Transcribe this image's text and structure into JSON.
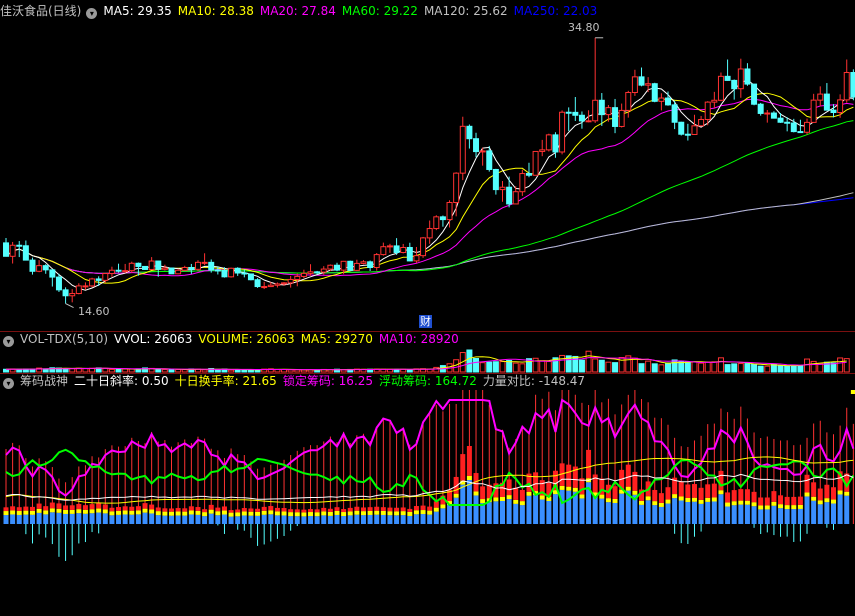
{
  "main_legend": {
    "title": "佳沃食品(日线)",
    "items": [
      {
        "text": "MA5: 29.35",
        "color": "#ffffff"
      },
      {
        "text": "MA10: 28.38",
        "color": "#ffff00"
      },
      {
        "text": "MA20: 27.84",
        "color": "#ff00ff"
      },
      {
        "text": "MA60: 29.22",
        "color": "#00ff00"
      },
      {
        "text": "MA120: 25.62",
        "color": "#c0c0c0"
      },
      {
        "text": "MA250: 22.03",
        "color": "#0000ff"
      }
    ]
  },
  "high_label": "34.80",
  "low_label": "14.60",
  "cai_marker": "财",
  "vol_legend": {
    "items": [
      {
        "text": "VOL-TDX(5,10)",
        "color": "#c0c0c0"
      },
      {
        "text": "VVOL: 26063",
        "color": "#ffffff"
      },
      {
        "text": "VOLUME: 26063",
        "color": "#ffff00"
      },
      {
        "text": "MA5: 29270",
        "color": "#ffff00"
      },
      {
        "text": "MA10: 28920",
        "color": "#ff00ff"
      }
    ]
  },
  "ind_legend": {
    "items": [
      {
        "text": "筹码战神",
        "color": "#c0c0c0"
      },
      {
        "text": "二十日斜率: 0.50",
        "color": "#ffffff"
      },
      {
        "text": "十日换手率: 21.65",
        "color": "#ffff00"
      },
      {
        "text": "锁定筹码: 16.25",
        "color": "#ff00ff"
      },
      {
        "text": "浮动筹码: 164.72",
        "color": "#00ff00"
      },
      {
        "text": "力量对比: -148.47",
        "color": "#c0c0c0"
      }
    ]
  },
  "colors": {
    "up": "#ff3232",
    "down": "#54ffff",
    "ma5": "#ffffff",
    "ma10": "#ffff00",
    "ma20": "#ff00ff",
    "ma60": "#00ff00",
    "ma120": "#c0c0c0",
    "ma250": "#0000ff"
  },
  "chart_data": {
    "type": "candlestick",
    "price_range": [
      13.5,
      36.0
    ],
    "ohlc": [
      [
        19.21,
        19.58,
        18.18,
        18.19
      ],
      [
        18.19,
        19.28,
        17.64,
        19.03
      ],
      [
        19.03,
        19.35,
        18.13,
        18.99
      ],
      [
        18.99,
        19.39,
        17.88,
        17.9
      ],
      [
        17.9,
        18.09,
        16.8,
        17.05
      ],
      [
        17.05,
        17.9,
        16.98,
        17.48
      ],
      [
        17.48,
        17.59,
        16.86,
        17.16
      ],
      [
        17.16,
        17.19,
        15.89,
        16.61
      ],
      [
        16.61,
        16.86,
        15.48,
        15.64
      ],
      [
        15.64,
        15.83,
        14.6,
        15.19
      ],
      [
        15.19,
        15.69,
        14.69,
        15.36
      ],
      [
        15.36,
        16.14,
        15.3,
        15.94
      ],
      [
        15.94,
        16.21,
        15.64,
        15.94
      ],
      [
        15.94,
        16.56,
        15.84,
        16.47
      ],
      [
        16.47,
        16.67,
        15.94,
        16.36
      ],
      [
        16.36,
        16.93,
        16.17,
        16.88
      ],
      [
        16.88,
        17.4,
        16.63,
        17.13
      ],
      [
        17.13,
        17.63,
        16.96,
        17.06
      ],
      [
        17.06,
        17.61,
        16.91,
        17.1
      ],
      [
        17.1,
        17.78,
        16.94,
        17.66
      ],
      [
        17.66,
        17.72,
        16.72,
        17.42
      ],
      [
        17.42,
        17.44,
        17.16,
        17.19
      ],
      [
        17.19,
        18.13,
        17.18,
        17.83
      ],
      [
        17.83,
        17.86,
        16.64,
        17.2
      ],
      [
        17.2,
        17.55,
        17.12,
        17.3
      ],
      [
        17.3,
        17.33,
        16.84,
        16.86
      ],
      [
        16.86,
        17.25,
        16.83,
        17.13
      ],
      [
        17.13,
        17.47,
        17.08,
        17.34
      ],
      [
        17.34,
        17.61,
        16.84,
        17.2
      ],
      [
        17.2,
        17.89,
        17.07,
        17.73
      ],
      [
        17.73,
        18.42,
        17.52,
        17.73
      ],
      [
        17.73,
        17.95,
        16.95,
        17.15
      ],
      [
        17.15,
        17.43,
        16.81,
        17.11
      ],
      [
        17.11,
        17.36,
        16.57,
        16.63
      ],
      [
        16.63,
        17.33,
        16.57,
        17.28
      ],
      [
        17.28,
        17.36,
        16.7,
        16.92
      ],
      [
        16.92,
        17.21,
        16.59,
        16.85
      ],
      [
        16.85,
        16.86,
        16.36,
        16.41
      ],
      [
        16.41,
        16.53,
        15.79,
        15.89
      ],
      [
        15.89,
        16.25,
        15.7,
        15.89
      ],
      [
        15.89,
        16.23,
        15.85,
        15.99
      ],
      [
        15.99,
        16.2,
        15.82,
        16.09
      ],
      [
        16.09,
        16.23,
        15.95,
        16.17
      ],
      [
        16.17,
        16.7,
        15.81,
        16.43
      ],
      [
        16.43,
        16.87,
        15.91,
        16.66
      ],
      [
        16.66,
        17.17,
        16.53,
        16.89
      ],
      [
        16.89,
        17.59,
        16.71,
        17.01
      ],
      [
        17.01,
        17.08,
        16.82,
        16.99
      ],
      [
        16.99,
        17.44,
        16.78,
        17.22
      ],
      [
        17.22,
        17.57,
        17.07,
        17.51
      ],
      [
        17.51,
        17.7,
        17.05,
        17.14
      ],
      [
        17.14,
        17.84,
        16.83,
        17.81
      ],
      [
        17.81,
        17.86,
        17.08,
        17.12
      ],
      [
        17.12,
        17.93,
        17.07,
        17.65
      ],
      [
        17.65,
        17.9,
        17.58,
        17.77
      ],
      [
        17.77,
        17.87,
        17.07,
        17.34
      ],
      [
        17.34,
        18.44,
        17.1,
        18.32
      ],
      [
        18.32,
        19.23,
        18.24,
        18.92
      ],
      [
        18.92,
        19.14,
        18.45,
        18.98
      ],
      [
        18.98,
        19.57,
        18.3,
        18.48
      ],
      [
        18.48,
        19.13,
        18.41,
        18.86
      ],
      [
        18.86,
        19.22,
        17.82,
        17.84
      ],
      [
        17.84,
        18.9,
        17.69,
        18.24
      ],
      [
        18.24,
        19.66,
        18.07,
        19.59
      ],
      [
        19.59,
        20.91,
        19.14,
        20.3
      ],
      [
        20.3,
        21.31,
        20.18,
        21.19
      ],
      [
        21.19,
        21.29,
        20.44,
        20.98
      ],
      [
        20.98,
        22.45,
        20.38,
        22.28
      ],
      [
        22.28,
        24.58,
        21.23,
        24.51
      ],
      [
        24.51,
        28.8,
        23.98,
        28.07
      ],
      [
        28.07,
        28.21,
        26.38,
        27.13
      ],
      [
        27.13,
        27.58,
        25.72,
        26.15
      ],
      [
        26.15,
        26.45,
        25.08,
        26.2
      ],
      [
        26.2,
        26.58,
        24.63,
        24.79
      ],
      [
        24.79,
        24.84,
        22.88,
        23.26
      ],
      [
        23.26,
        23.91,
        22.34,
        23.44
      ],
      [
        23.44,
        24.25,
        21.91,
        22.17
      ],
      [
        22.17,
        23.52,
        22.17,
        23.1
      ],
      [
        23.1,
        24.77,
        22.78,
        24.48
      ],
      [
        24.48,
        25.3,
        24.2,
        24.35
      ],
      [
        24.35,
        26.16,
        24.34,
        26.16
      ],
      [
        26.16,
        27.04,
        25.8,
        26.28
      ],
      [
        26.28,
        27.51,
        26.16,
        27.42
      ],
      [
        27.42,
        27.62,
        25.68,
        26.12
      ],
      [
        26.12,
        29.28,
        25.94,
        29.14
      ],
      [
        29.14,
        29.51,
        27.71,
        29.13
      ],
      [
        29.13,
        30.3,
        28.48,
        28.91
      ],
      [
        28.91,
        29.2,
        27.89,
        28.48
      ],
      [
        28.48,
        29.29,
        28.37,
        28.49
      ],
      [
        28.49,
        34.8,
        28.33,
        30.05
      ],
      [
        30.05,
        30.6,
        28.1,
        28.96
      ],
      [
        28.96,
        29.69,
        28.42,
        29.49
      ],
      [
        29.49,
        30.15,
        27.55,
        28.06
      ],
      [
        28.06,
        29.8,
        27.98,
        29.28
      ],
      [
        29.28,
        30.77,
        28.73,
        30.64
      ],
      [
        30.64,
        32.37,
        30.38,
        31.83
      ],
      [
        31.83,
        32.54,
        31.11,
        31.2
      ],
      [
        31.2,
        31.81,
        30.67,
        31.31
      ],
      [
        31.31,
        31.38,
        29.9,
        29.97
      ],
      [
        29.97,
        30.58,
        29.28,
        30.22
      ],
      [
        30.22,
        30.72,
        29.63,
        29.7
      ],
      [
        29.7,
        30.02,
        27.86,
        28.38
      ],
      [
        28.38,
        28.42,
        27.37,
        27.47
      ],
      [
        27.47,
        28.26,
        26.99,
        27.45
      ],
      [
        27.45,
        28.95,
        27.42,
        28.11
      ],
      [
        28.11,
        28.86,
        28.06,
        28.59
      ],
      [
        28.59,
        29.98,
        28.15,
        29.91
      ],
      [
        29.91,
        30.69,
        29.46,
        30.05
      ],
      [
        30.05,
        32.16,
        29.98,
        31.87
      ],
      [
        31.87,
        33.15,
        31.54,
        31.56
      ],
      [
        31.56,
        31.63,
        30.1,
        30.93
      ],
      [
        30.93,
        33.21,
        30.24,
        32.43
      ],
      [
        32.43,
        32.87,
        31.15,
        31.28
      ],
      [
        31.28,
        31.29,
        29.67,
        29.75
      ],
      [
        29.75,
        29.85,
        28.88,
        29.05
      ],
      [
        29.05,
        29.31,
        28.35,
        29.08
      ],
      [
        29.08,
        29.22,
        28.66,
        28.69
      ],
      [
        28.69,
        29.08,
        28.33,
        28.38
      ],
      [
        28.38,
        28.76,
        27.69,
        28.32
      ],
      [
        28.32,
        28.64,
        27.61,
        27.67
      ],
      [
        27.67,
        28.57,
        27.59,
        27.62
      ],
      [
        27.62,
        28.66,
        27.45,
        28.37
      ],
      [
        28.37,
        30.54,
        28.36,
        30.06
      ],
      [
        30.06,
        31.11,
        29.58,
        30.52
      ],
      [
        30.52,
        31.36,
        29.3,
        29.3
      ],
      [
        29.3,
        29.76,
        28.75,
        29.12
      ],
      [
        29.12,
        30.5,
        28.72,
        30.08
      ],
      [
        30.08,
        33.15,
        29.87,
        32.16
      ],
      [
        32.16,
        32.4,
        30.05,
        30.3
      ]
    ],
    "volume": [
      6000,
      6700,
      6100,
      6500,
      6300,
      8600,
      6800,
      9300,
      8700,
      7300,
      7400,
      8300,
      7500,
      8200,
      9000,
      8000,
      5700,
      6200,
      6700,
      6400,
      6800,
      8900,
      7900,
      5900,
      5300,
      5200,
      5500,
      5300,
      6700,
      6200,
      4700,
      7700,
      5800,
      6600,
      4100,
      4500,
      5500,
      5200,
      5000,
      6300,
      6900,
      5600,
      5500,
      4700,
      4600,
      4400,
      4800,
      4600,
      5600,
      5000,
      6100,
      4800,
      5600,
      6400,
      5900,
      6100,
      6400,
      6100,
      5800,
      5700,
      5900,
      4900,
      6900,
      7200,
      6500,
      10100,
      14100,
      18100,
      27000,
      42800,
      48400,
      29700,
      20500,
      21600,
      22600,
      23000,
      25300,
      19500,
      18000,
      29300,
      30200,
      24800,
      23000,
      31300,
      36400,
      35500,
      34200,
      26100,
      45700,
      28700,
      25900,
      21600,
      20600,
      31900,
      35500,
      30500,
      18300,
      23900,
      18000,
      15800,
      19900,
      26500,
      23600,
      21800,
      22100,
      19500,
      21900,
      22400,
      31200,
      16300,
      17900,
      18600,
      18500,
      16700,
      12800,
      12800,
      17200,
      14300,
      13200,
      13200,
      13400,
      28500,
      23300,
      19000,
      21600,
      19900,
      30900,
      29400
    ],
    "ma_series": [
      "MA5",
      "MA10",
      "MA20",
      "MA60",
      "MA120",
      "MA250"
    ]
  }
}
